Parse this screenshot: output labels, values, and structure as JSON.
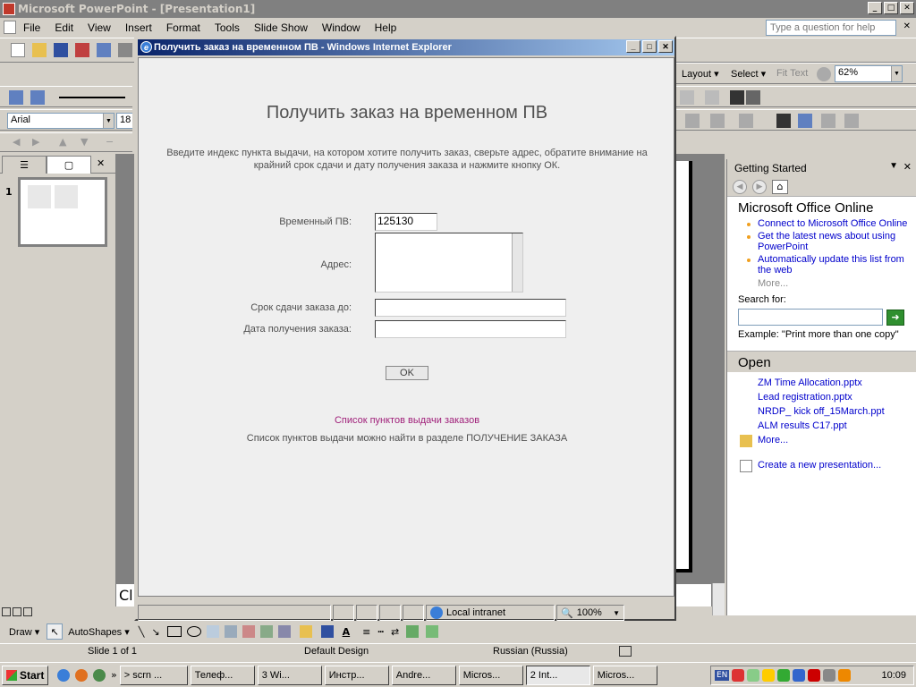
{
  "app": {
    "title": "Microsoft PowerPoint - [Presentation1]",
    "help_placeholder": "Type a question for help"
  },
  "menu": [
    "File",
    "Edit",
    "View",
    "Insert",
    "Format",
    "Tools",
    "Slide Show",
    "Window",
    "Help"
  ],
  "toolbar": {
    "font_name": "Arial",
    "font_size": "18",
    "layout_label": "Layout",
    "select_label": "Select",
    "fit_text_label": "Fit Text",
    "zoom": "62%"
  },
  "slides_pane": {
    "slide_number": "1"
  },
  "notes_text": "Cl",
  "task_pane": {
    "title": "Getting Started",
    "online_heading": "Microsoft Office Online",
    "links": [
      "Connect to Microsoft Office Online",
      "Get the latest news about using PowerPoint",
      "Automatically update this list from the web"
    ],
    "more1": "More...",
    "search_label": "Search for:",
    "example": "Example:  \"Print more than one copy\"",
    "open_heading": "Open",
    "files": [
      "ZM Time Allocation.pptx",
      "Lead registration.pptx",
      "NRDP_ kick off_15March.ppt",
      "ALM results C17.ppt"
    ],
    "more2": "More...",
    "create": "Create a new presentation..."
  },
  "draw_bar": {
    "draw": "Draw",
    "autoshapes": "AutoShapes"
  },
  "status": {
    "slide": "Slide 1 of 1",
    "design": "Default Design",
    "language": "Russian (Russia)"
  },
  "ie": {
    "title": "Получить заказ на временном ПВ - Windows Internet Explorer",
    "zone": "Local intranet",
    "zoom": "100%",
    "form": {
      "heading": "Получить заказ на временном ПВ",
      "description": "Введите индекс пункта выдачи, на котором хотите получить заказ, сверьте адрес, обратите внимание на крайний срок сдачи и дату получения заказа и нажмите кнопку ОК.",
      "pv_label": "Временный ПВ:",
      "pv_value": "125130",
      "address_label": "Адрес:",
      "deadline_label": "Срок сдачи заказа до:",
      "receive_label": "Дата получения заказа:",
      "ok": "OK",
      "link": "Список пунктов  выдачи заказов",
      "note": "Список пунктов  выдачи можно найти в разделе ПОЛУЧЕНИЕ ЗАКАЗА"
    }
  },
  "taskbar": {
    "start": "Start",
    "buttons": [
      "> scrn ...",
      "Телеф...",
      "3 Wi...",
      "Инстр...",
      "Andre...",
      "Micros...",
      "2 Int...",
      "Micros..."
    ],
    "lang": "EN",
    "clock": "10:09"
  }
}
